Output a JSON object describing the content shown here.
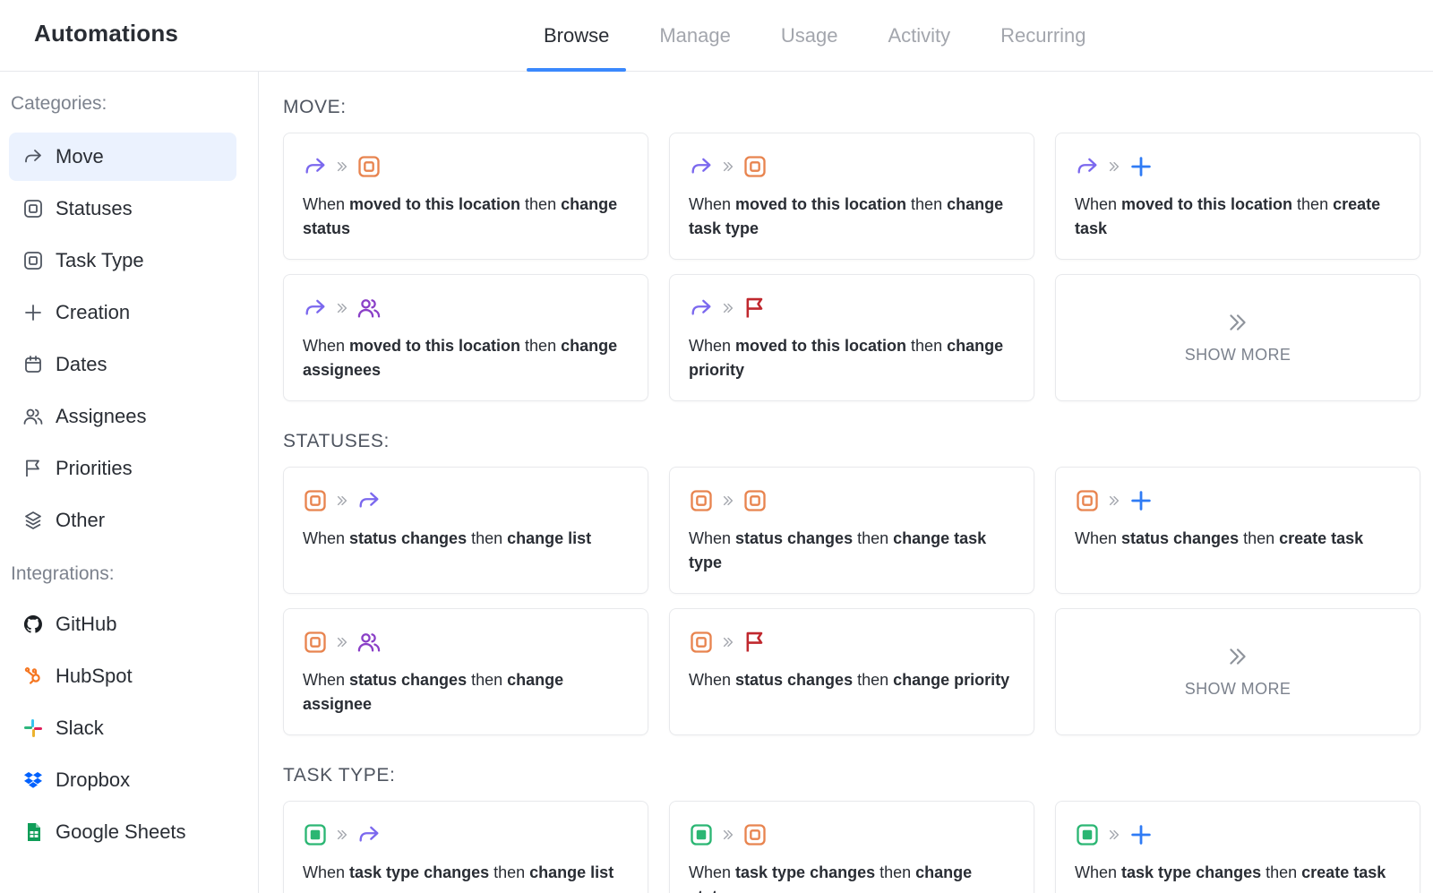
{
  "app": {
    "title": "Automations"
  },
  "tabs": [
    {
      "label": "Browse",
      "active": true
    },
    {
      "label": "Manage",
      "active": false
    },
    {
      "label": "Usage",
      "active": false
    },
    {
      "label": "Activity",
      "active": false
    },
    {
      "label": "Recurring",
      "active": false
    }
  ],
  "sidebar": {
    "categories_heading": "Categories:",
    "categories": [
      {
        "label": "Move",
        "icon": "move-arrow-icon",
        "active": true
      },
      {
        "label": "Statuses",
        "icon": "status-icon"
      },
      {
        "label": "Task Type",
        "icon": "task-type-icon"
      },
      {
        "label": "Creation",
        "icon": "plus-icon"
      },
      {
        "label": "Dates",
        "icon": "calendar-icon"
      },
      {
        "label": "Assignees",
        "icon": "assignees-icon"
      },
      {
        "label": "Priorities",
        "icon": "flag-icon"
      },
      {
        "label": "Other",
        "icon": "layers-icon"
      }
    ],
    "integrations_heading": "Integrations:",
    "integrations": [
      {
        "label": "GitHub",
        "icon": "github-icon"
      },
      {
        "label": "HubSpot",
        "icon": "hubspot-icon"
      },
      {
        "label": "Slack",
        "icon": "slack-icon"
      },
      {
        "label": "Dropbox",
        "icon": "dropbox-icon"
      },
      {
        "label": "Google Sheets",
        "icon": "google-sheets-icon"
      }
    ]
  },
  "colors": {
    "accent_blue": "#3a88fd",
    "move_purple": "#7b68ee",
    "status_orange": "#e8844f",
    "plus_blue": "#2f7bf5",
    "assignee_purple": "#8a3fc7",
    "priority_red": "#c0282e",
    "task_type_green": "#2bb673"
  },
  "sections": [
    {
      "title": "MOVE:",
      "cards": [
        {
          "trigger_icon": "move-arrow-icon",
          "action_icon": "status-icon",
          "parts": [
            "When ",
            "moved to this location",
            " then ",
            "change status"
          ]
        },
        {
          "trigger_icon": "move-arrow-icon",
          "action_icon": "status-icon",
          "parts": [
            "When ",
            "moved to this location",
            " then ",
            "change task type"
          ]
        },
        {
          "trigger_icon": "move-arrow-icon",
          "action_icon": "plus-icon",
          "parts": [
            "When ",
            "moved to this location",
            " then ",
            "create task"
          ]
        },
        {
          "trigger_icon": "move-arrow-icon",
          "action_icon": "assignees-icon",
          "parts": [
            "When ",
            "moved to this location",
            " then ",
            "change assignees"
          ]
        },
        {
          "trigger_icon": "move-arrow-icon",
          "action_icon": "flag-icon",
          "parts": [
            "When ",
            "moved to this location",
            " then ",
            "change priority"
          ]
        },
        {
          "show_more": "SHOW MORE"
        }
      ]
    },
    {
      "title": "STATUSES:",
      "cards": [
        {
          "trigger_icon": "status-icon",
          "action_icon": "move-arrow-icon",
          "parts": [
            "When ",
            "status changes",
            " then ",
            "change list"
          ]
        },
        {
          "trigger_icon": "status-icon",
          "action_icon": "status-icon",
          "parts": [
            "When ",
            "status changes",
            " then ",
            "change task type"
          ]
        },
        {
          "trigger_icon": "status-icon",
          "action_icon": "plus-icon",
          "parts": [
            "When ",
            "status changes",
            " then ",
            "create task"
          ]
        },
        {
          "trigger_icon": "status-icon",
          "action_icon": "assignees-icon",
          "parts": [
            "When ",
            "status changes",
            " then ",
            "change assignee"
          ]
        },
        {
          "trigger_icon": "status-icon",
          "action_icon": "flag-icon",
          "parts": [
            "When ",
            "status changes",
            " then ",
            "change priority"
          ]
        },
        {
          "show_more": "SHOW MORE"
        }
      ]
    },
    {
      "title": "TASK TYPE:",
      "cards": [
        {
          "trigger_icon": "task-type-icon",
          "action_icon": "move-arrow-icon",
          "parts": [
            "When ",
            "task type changes",
            " then ",
            "change list"
          ]
        },
        {
          "trigger_icon": "task-type-icon",
          "action_icon": "status-icon",
          "parts": [
            "When ",
            "task type changes",
            " then ",
            "change status"
          ]
        },
        {
          "trigger_icon": "task-type-icon",
          "action_icon": "plus-icon",
          "parts": [
            "When ",
            "task type changes",
            " then ",
            "create task"
          ]
        }
      ]
    }
  ]
}
